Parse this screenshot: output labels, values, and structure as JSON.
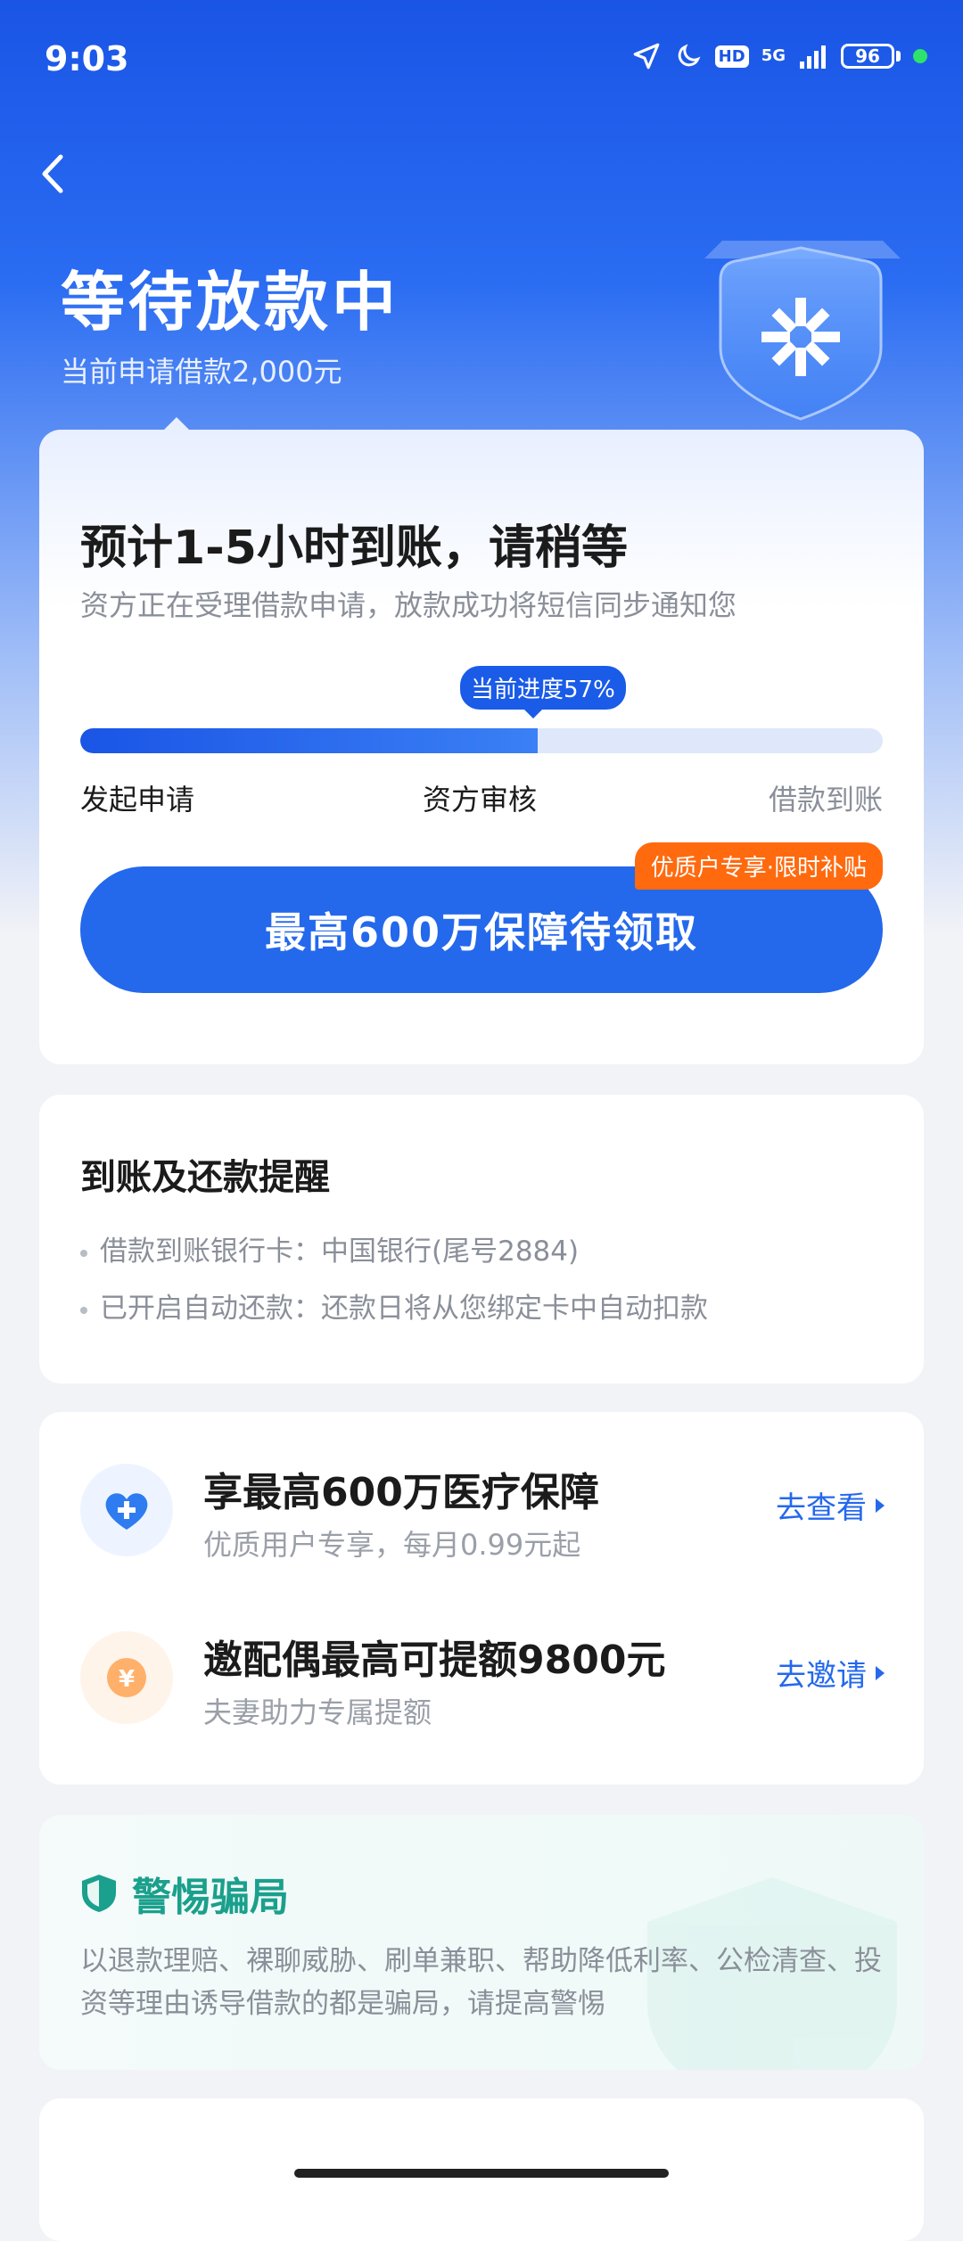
{
  "status_bar": {
    "time": "9:03",
    "network": "5G",
    "hd": "HD",
    "battery": "96"
  },
  "header": {
    "title": "等待放款中",
    "subtitle": "当前申请借款2,000元"
  },
  "main_card": {
    "title": "预计1-5小时到账，请稍等",
    "description": "资方正在受理借款申请，放款成功将短信同步通知您",
    "progress_label": "当前进度57%",
    "progress_value": 57,
    "steps": [
      "发起申请",
      "资方审核",
      "借款到账"
    ],
    "cta_label": "最高600万保障待领取",
    "cta_badge": "优质户专享·限时补贴"
  },
  "reminder": {
    "title": "到账及还款提醒",
    "items": [
      "借款到账银行卡：中国银行(尾号2884)",
      "已开启自动还款：还款日将从您绑定卡中自动扣款"
    ]
  },
  "offers": [
    {
      "title": "享最高600万医疗保障",
      "subtitle": "优质用户专享，每月0.99元起",
      "link": "去查看",
      "icon": "heart-plus-icon"
    },
    {
      "title": "邀配偶最高可提额9800元",
      "subtitle": "夫妻助力专属提额",
      "link": "去邀请",
      "icon": "yuan-coin-icon"
    }
  ],
  "warning": {
    "title": "警惕骗局",
    "text": "以退款理赔、裸聊威胁、刷单兼职、帮助降低利率、公检清查、投资等理由诱导借款的都是骗局，请提高警惕"
  },
  "colors": {
    "primary": "#2468ec",
    "accent_orange": "#ff6a0f",
    "warn_green": "#1aa08c"
  }
}
